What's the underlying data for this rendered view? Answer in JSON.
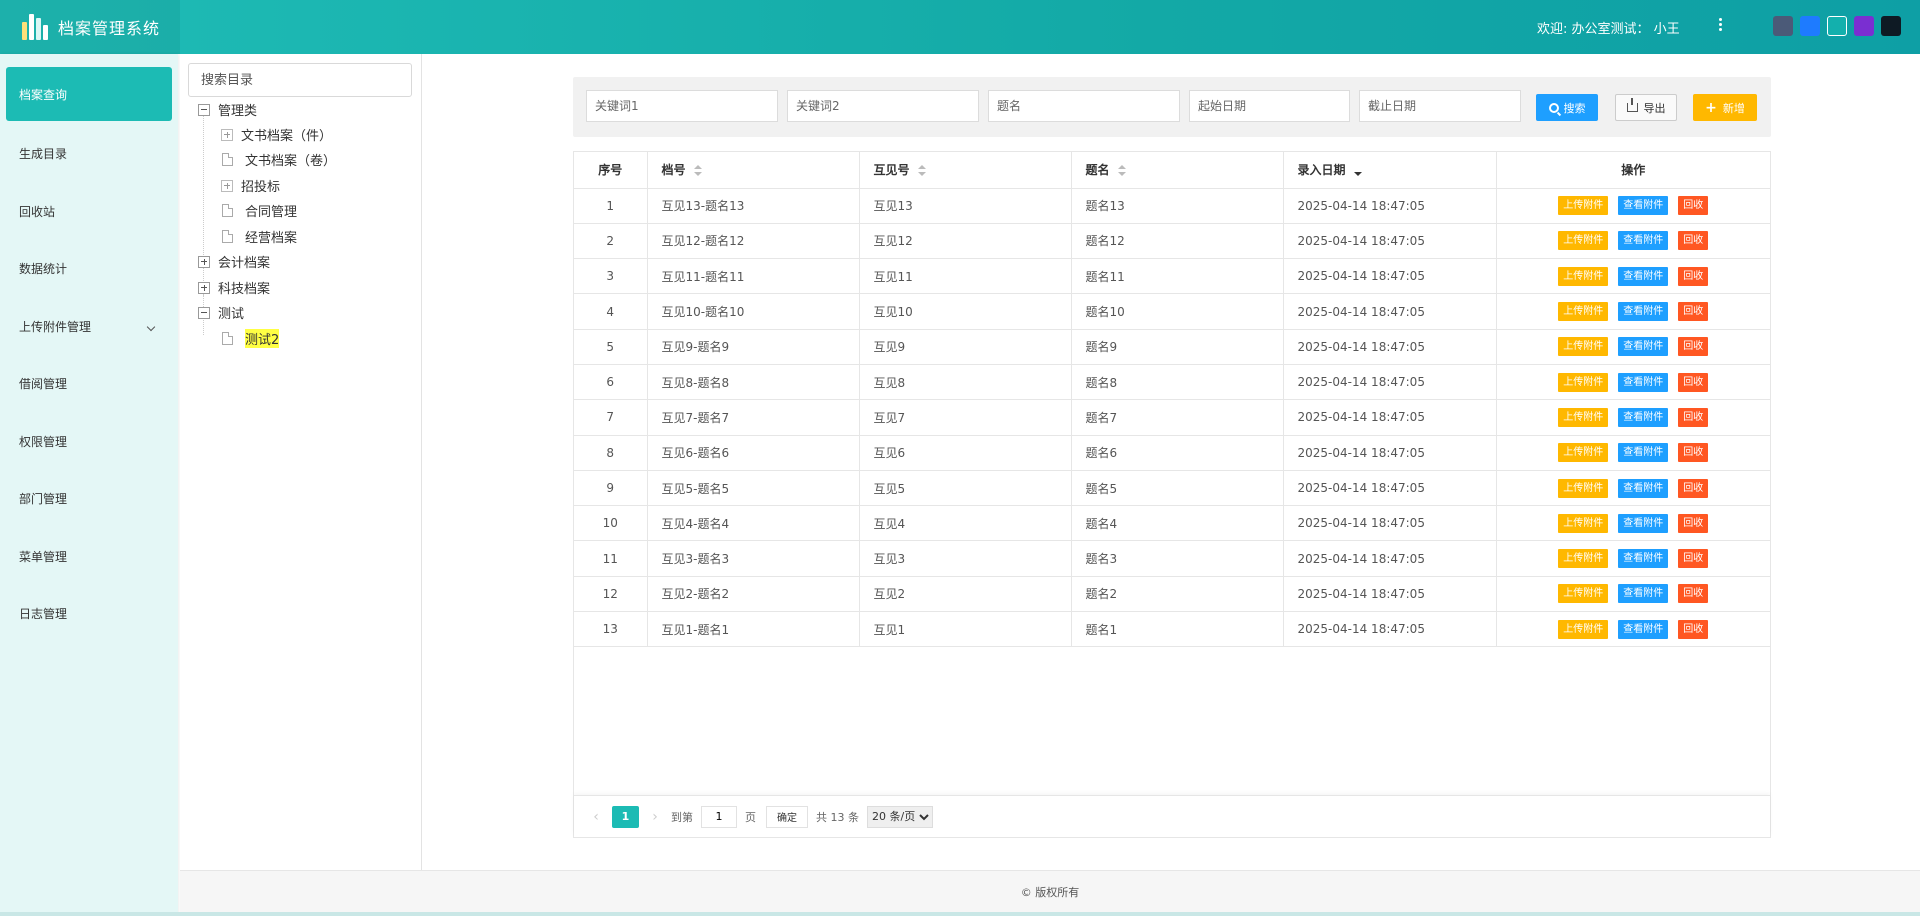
{
  "app": {
    "title": "档案管理系统"
  },
  "header": {
    "welcome": "欢迎: 办公室测试： 小王",
    "theme_colors": [
      "#4b5a78",
      "#1e7bff",
      "#13b0ad",
      "#7a2fd1",
      "#0e1a24"
    ]
  },
  "menu": {
    "items": [
      {
        "label": "档案查询"
      },
      {
        "label": "生成目录"
      },
      {
        "label": "回收站"
      },
      {
        "label": "数据统计"
      },
      {
        "label": "上传附件管理"
      },
      {
        "label": "借阅管理"
      },
      {
        "label": "权限管理"
      },
      {
        "label": "部门管理"
      },
      {
        "label": "菜单管理"
      },
      {
        "label": "日志管理"
      }
    ]
  },
  "tree": {
    "search_placeholder": "搜索目录",
    "nodes": [
      {
        "label": "管理类"
      },
      {
        "label": "文书档案（件）"
      },
      {
        "label": "文书档案（卷）"
      },
      {
        "label": "招投标"
      },
      {
        "label": "合同管理"
      },
      {
        "label": "经营档案"
      },
      {
        "label": "会计档案"
      },
      {
        "label": "科技档案"
      },
      {
        "label": "测试"
      },
      {
        "label": "测试2"
      }
    ]
  },
  "filters": {
    "keyword1": "关键词1",
    "keyword2": "关键词2",
    "title": "题名",
    "start_date": "起始日期",
    "end_date": "截止日期",
    "search_label": "搜索",
    "export_label": "导出",
    "add_label": "新增"
  },
  "table": {
    "columns": [
      "序号",
      "档号",
      "互见号",
      "题名",
      "录入日期",
      "操作"
    ],
    "actions": {
      "upload": "上传附件",
      "view": "查看附件",
      "recycle": "回收"
    },
    "rows": [
      {
        "idx": "1",
        "code": "互见13-题名13",
        "ref": "互见13",
        "title": "题名13",
        "date": "2025-04-14 18:47:05"
      },
      {
        "idx": "2",
        "code": "互见12-题名12",
        "ref": "互见12",
        "title": "题名12",
        "date": "2025-04-14 18:47:05"
      },
      {
        "idx": "3",
        "code": "互见11-题名11",
        "ref": "互见11",
        "title": "题名11",
        "date": "2025-04-14 18:47:05"
      },
      {
        "idx": "4",
        "code": "互见10-题名10",
        "ref": "互见10",
        "title": "题名10",
        "date": "2025-04-14 18:47:05"
      },
      {
        "idx": "5",
        "code": "互见9-题名9",
        "ref": "互见9",
        "title": "题名9",
        "date": "2025-04-14 18:47:05"
      },
      {
        "idx": "6",
        "code": "互见8-题名8",
        "ref": "互见8",
        "title": "题名8",
        "date": "2025-04-14 18:47:05"
      },
      {
        "idx": "7",
        "code": "互见7-题名7",
        "ref": "互见7",
        "title": "题名7",
        "date": "2025-04-14 18:47:05"
      },
      {
        "idx": "8",
        "code": "互见6-题名6",
        "ref": "互见6",
        "title": "题名6",
        "date": "2025-04-14 18:47:05"
      },
      {
        "idx": "9",
        "code": "互见5-题名5",
        "ref": "互见5",
        "title": "题名5",
        "date": "2025-04-14 18:47:05"
      },
      {
        "idx": "10",
        "code": "互见4-题名4",
        "ref": "互见4",
        "title": "题名4",
        "date": "2025-04-14 18:47:05"
      },
      {
        "idx": "11",
        "code": "互见3-题名3",
        "ref": "互见3",
        "title": "题名3",
        "date": "2025-04-14 18:47:05"
      },
      {
        "idx": "12",
        "code": "互见2-题名2",
        "ref": "互见2",
        "title": "题名2",
        "date": "2025-04-14 18:47:05"
      },
      {
        "idx": "13",
        "code": "互见1-题名1",
        "ref": "互见1",
        "title": "题名1",
        "date": "2025-04-14 18:47:05"
      }
    ]
  },
  "pager": {
    "current_page": "1",
    "goto_prefix": "到第",
    "goto_value": "1",
    "goto_suffix": "页",
    "confirm": "确定",
    "total": "共 13 条",
    "page_size": "20 条/页"
  },
  "footer": {
    "text": "© 版权所有"
  }
}
